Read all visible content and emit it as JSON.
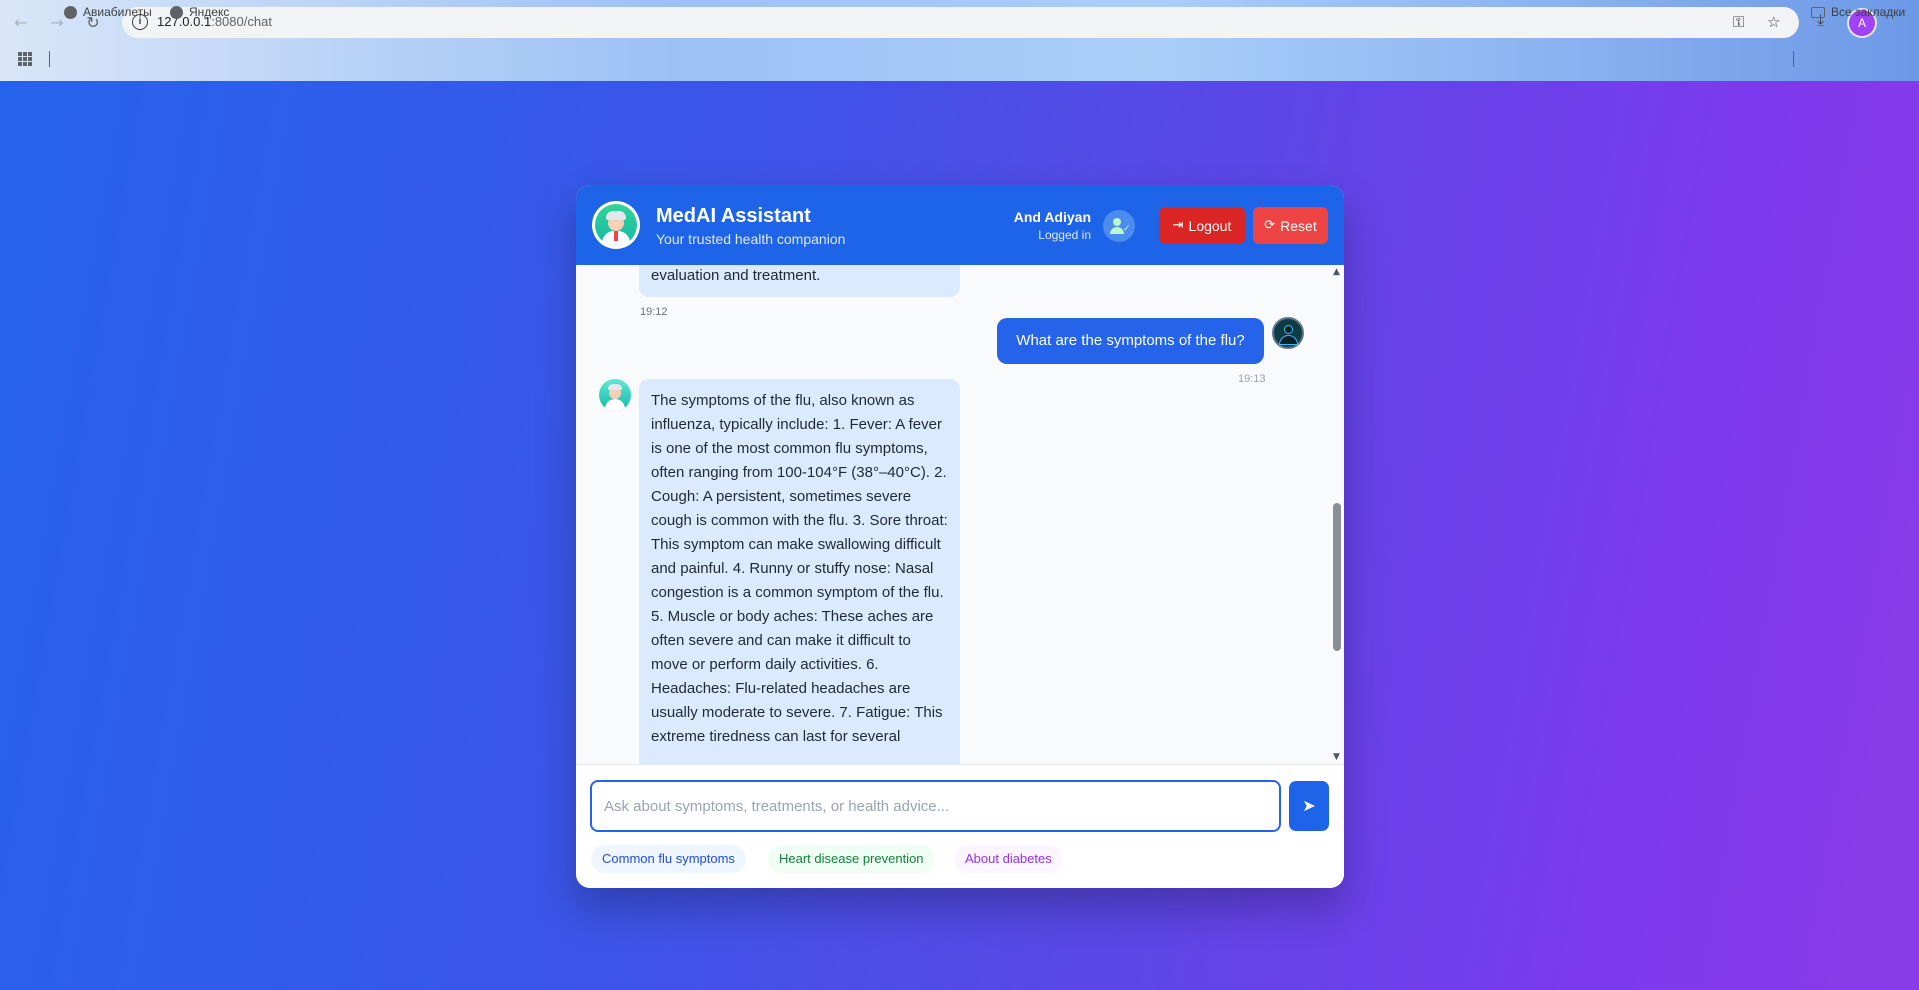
{
  "browser": {
    "url_host": "127.0.0.1",
    "url_rest": ":8080/chat",
    "bookmarks": [
      "Авиабилеты",
      "Яндекс"
    ],
    "all_bookmarks": "Все закладки",
    "profile_initial": "A"
  },
  "header": {
    "title": "MedAI Assistant",
    "subtitle": "Your trusted health companion",
    "user_name": "And Adiyan",
    "user_status": "Logged in",
    "logout_label": "Logout",
    "reset_label": "Reset"
  },
  "messages": [
    {
      "role": "bot",
      "text": "evaluation and treatment.",
      "time": "19:12"
    },
    {
      "role": "user",
      "text": "What are the symptoms of the flu?",
      "time": "19:13"
    },
    {
      "role": "bot",
      "text": "The symptoms of the flu, also known as influenza, typically include: 1. Fever: A fever is one of the most common flu symptoms, often ranging from 100-104°F (38°–40°C). 2. Cough: A persistent, sometimes severe cough is common with the flu. 3. Sore throat: This symptom can make swallowing difficult and painful. 4. Runny or stuffy nose: Nasal congestion is a common symptom of the flu. 5. Muscle or body aches: These aches are often severe and can make it difficult to move or perform daily activities. 6. Headaches: Flu-related headaches are usually moderate to severe. 7. Fatigue: This extreme tiredness can last for several"
    }
  ],
  "input": {
    "placeholder": "Ask about symptoms, treatments, or health advice...",
    "value": ""
  },
  "suggestions": [
    "Common flu symptoms",
    "Heart disease prevention",
    "About diabetes"
  ],
  "colors": {
    "header": "#1d64e8",
    "logout": "#dc2626",
    "reset": "#ef4444",
    "bot_bubble": "#dbeafe",
    "user_bubble": "#2563eb"
  },
  "icons": [
    "back-arrow-icon",
    "forward-arrow-icon",
    "reload-icon",
    "site-info-icon",
    "password-key-icon",
    "star-icon",
    "download-icon",
    "apps-grid-icon",
    "globe-icon",
    "folder-icon",
    "doctor-avatar-icon",
    "user-check-icon",
    "sign-out-icon",
    "refresh-icon",
    "user-avatar-icon",
    "paper-plane-icon"
  ]
}
